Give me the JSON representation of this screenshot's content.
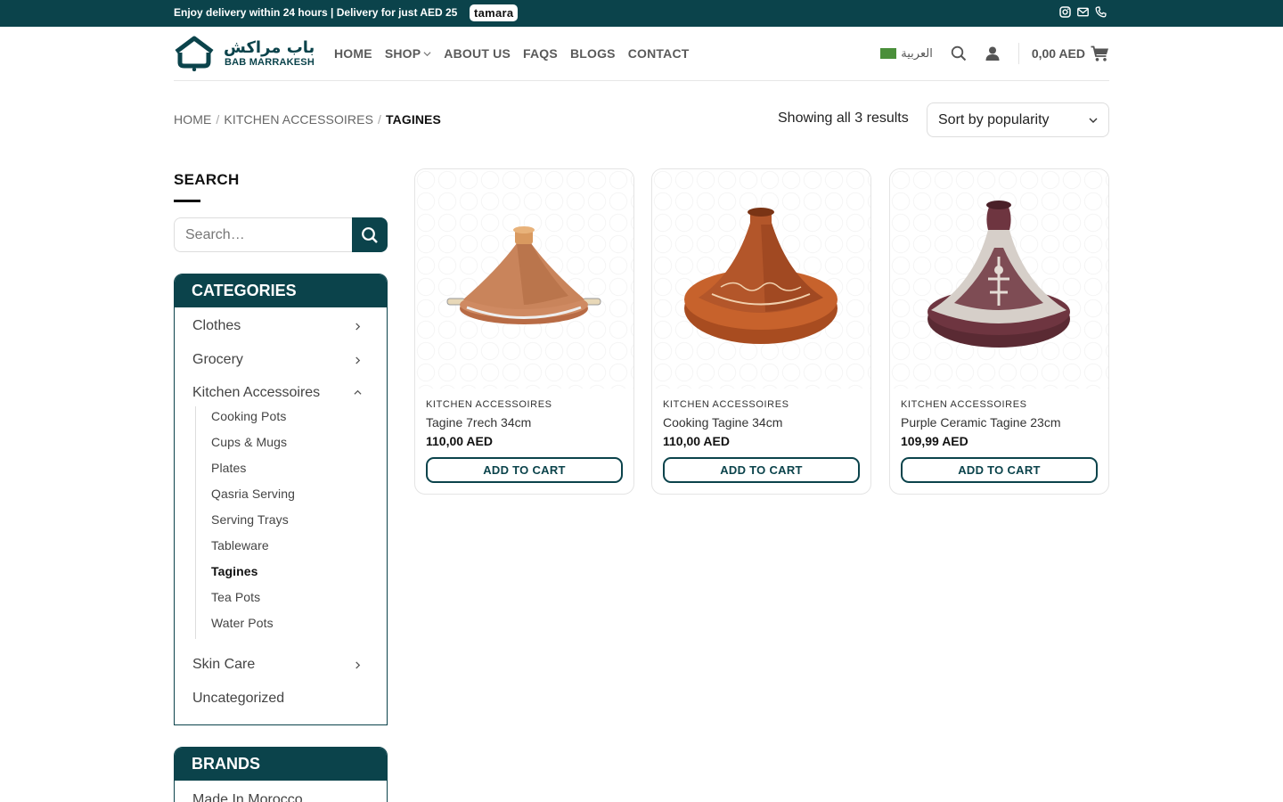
{
  "topbar": {
    "message": "Enjoy delivery within 24 hours | Delivery for just AED 25",
    "badge": "tamara",
    "icons": [
      "instagram-icon",
      "mail-icon",
      "phone-icon"
    ]
  },
  "header": {
    "logo_arabic": "باب مراكش",
    "logo_english": "BAB MARRAKESH",
    "nav": [
      "HOME",
      "SHOP",
      "ABOUT US",
      "FAQS",
      "BLOGS",
      "CONTACT"
    ],
    "language": "العربية",
    "cart_total": "0,00 AED"
  },
  "breadcrumb": {
    "items": [
      "HOME",
      "KITCHEN ACCESSOIRES"
    ],
    "current": "TAGINES"
  },
  "results_text": "Showing all 3 results",
  "sort": {
    "selected": "Sort by popularity"
  },
  "sidebar": {
    "search_title": "SEARCH",
    "search_placeholder": "Search…",
    "categories_title": "CATEGORIES",
    "categories": [
      "Clothes",
      "Grocery",
      "Kitchen Accessoires",
      "Skin Care",
      "Uncategorized"
    ],
    "subcategories": [
      "Cooking Pots",
      "Cups & Mugs",
      "Plates",
      "Qasria Serving",
      "Serving Trays",
      "Tableware",
      "Tagines",
      "Tea Pots",
      "Water Pots"
    ],
    "active_subcategory": "Tagines",
    "brands_title": "BRANDS",
    "brands": [
      "Made In Morocco"
    ]
  },
  "products": [
    {
      "category": "KITCHEN ACCESSOIRES",
      "name": "Tagine 7rech 34cm",
      "price": "110,00 AED",
      "button": "ADD TO CART"
    },
    {
      "category": "KITCHEN ACCESSOIRES",
      "name": "Cooking Tagine 34cm",
      "price": "110,00 AED",
      "button": "ADD TO CART"
    },
    {
      "category": "KITCHEN ACCESSOIRES",
      "name": "Purple Ceramic Tagine 23cm",
      "price": "109,99 AED",
      "button": "ADD TO CART"
    }
  ],
  "colors": {
    "brand": "#0b434b"
  }
}
